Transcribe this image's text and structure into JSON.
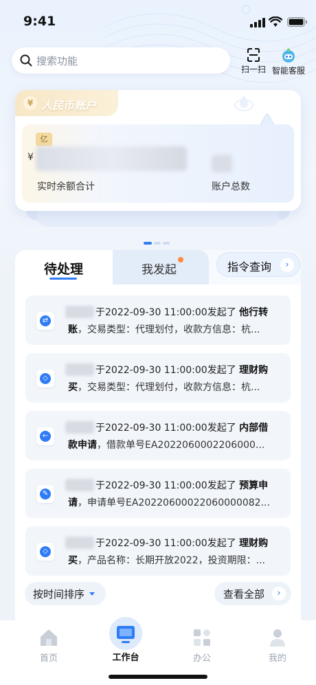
{
  "status_bar": {
    "time": "9:41"
  },
  "search": {
    "placeholder": "搜索功能"
  },
  "header_tools": [
    {
      "label": "扫一扫",
      "icon": "scan-icon"
    },
    {
      "label": "智能客服",
      "icon": "robot-icon"
    }
  ],
  "account_card": {
    "tag": "人民币账户",
    "unit_badge": "亿",
    "currency_symbol": "¥",
    "balance_label": "实时余额合计",
    "count_label": "账户总数"
  },
  "tabs": [
    {
      "label": "待处理",
      "active": true
    },
    {
      "label": "我发起",
      "active": false,
      "badge_dot": true
    }
  ],
  "command_query": {
    "label": "指令查询"
  },
  "tasks": [
    {
      "prefix": "于2022-09-30 11:00:00发起了 ",
      "type_head": "他行转",
      "type_tail": "账",
      "detail": "，交易类型：代理划付，收款方信息：杭...",
      "icon": "transfer-icon"
    },
    {
      "prefix": "于2022-09-30 11:00:00发起了 ",
      "type_head": "理财购",
      "type_tail": "买",
      "detail": "，交易类型：代理划付，收款方信息：杭...",
      "icon": "diamond-icon"
    },
    {
      "prefix": "于2022-09-30 11:00:00发起了 ",
      "type_head": "内部借",
      "type_tail": "款申请",
      "detail": "，借款单号EA2022060002206000...",
      "icon": "loan-icon"
    },
    {
      "prefix": "于2022-09-30 11:00:00发起了 ",
      "type_head": "预算申",
      "type_tail": "请",
      "detail": "，申请单号EA20220600022060000082...",
      "icon": "edit-icon"
    },
    {
      "prefix": "于2022-09-30 11:00:00发起了 ",
      "type_head": "理财购",
      "type_tail": "买",
      "detail": "，产品名称：长期开放2022，投资期限：...",
      "icon": "diamond-icon"
    }
  ],
  "footer_actions": {
    "sort": "按时间排序",
    "view_all": "查看全部"
  },
  "bottom_nav": [
    {
      "label": "首页",
      "active": false
    },
    {
      "label": "工作台",
      "active": true
    },
    {
      "label": "办公",
      "active": false
    },
    {
      "label": "我的",
      "active": false
    }
  ],
  "colors": {
    "accent": "#2f7cf6",
    "badge_dot": "#ff8a3d",
    "gold": "#f3d89f"
  }
}
